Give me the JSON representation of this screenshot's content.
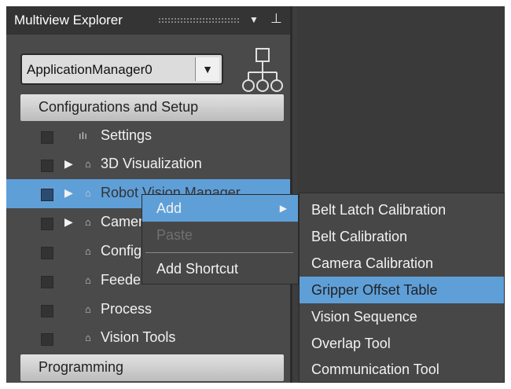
{
  "panel": {
    "title": "Multiview Explorer",
    "pin_icon": "pin-icon",
    "menu_icon": "caret-down-icon",
    "app_selector": {
      "value": "ApplicationManager0"
    }
  },
  "tree": {
    "sections": [
      {
        "label": "Configurations and Setup"
      },
      {
        "label": "Programming"
      }
    ],
    "items": [
      {
        "label": "Settings"
      },
      {
        "label": "3D Visualization"
      },
      {
        "label": "Robot Vision Manager"
      },
      {
        "label": "Camer"
      },
      {
        "label": "Config"
      },
      {
        "label": "Feeders"
      },
      {
        "label": "Process"
      },
      {
        "label": "Vision Tools"
      }
    ]
  },
  "context_menu": {
    "items": [
      {
        "label": "Add"
      },
      {
        "label": "Paste"
      },
      {
        "label": "Add Shortcut"
      }
    ]
  },
  "submenu": {
    "items": [
      {
        "label": "Belt Latch Calibration"
      },
      {
        "label": "Belt Calibration"
      },
      {
        "label": "Camera Calibration"
      },
      {
        "label": "Gripper Offset Table"
      },
      {
        "label": "Vision Sequence"
      },
      {
        "label": "Overlap Tool"
      },
      {
        "label": "Communication Tool"
      }
    ]
  },
  "colors": {
    "accent": "#5f9fd8",
    "panel_bg": "#4a4a4a",
    "menu_bg": "#474747"
  }
}
